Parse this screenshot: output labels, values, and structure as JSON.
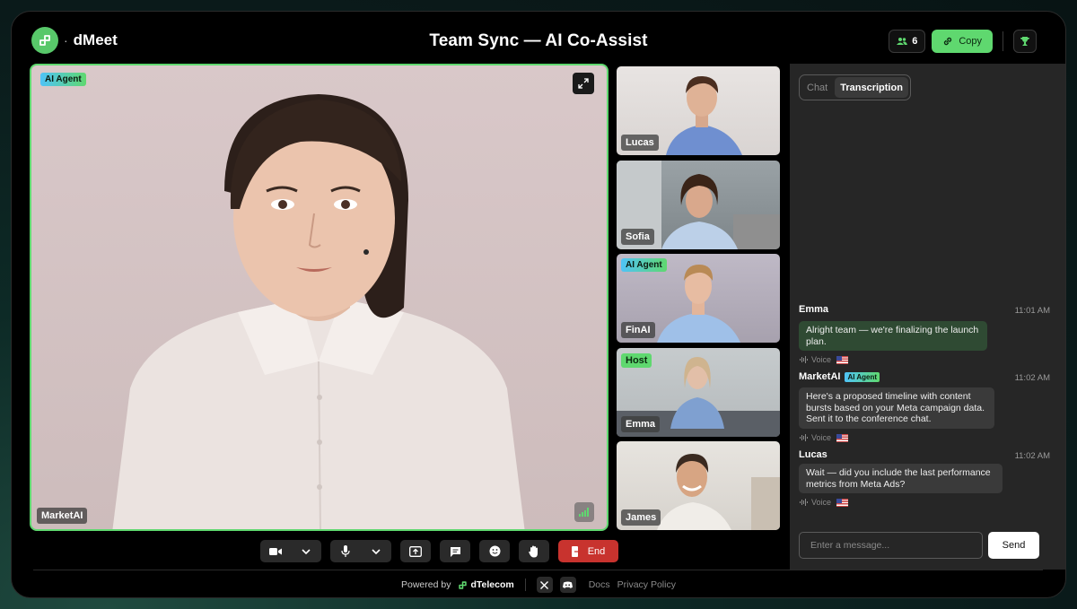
{
  "header": {
    "brand": "dMeet",
    "title": "Team Sync — AI Co-Assist",
    "participant_count": "6",
    "copy_label": "Copy"
  },
  "main_video": {
    "tag": "AI Agent",
    "name": "MarketAI"
  },
  "tiles": [
    {
      "name": "Lucas",
      "tag": ""
    },
    {
      "name": "Sofia",
      "tag": ""
    },
    {
      "name": "FinAI",
      "tag": "AI Agent"
    },
    {
      "name": "Emma",
      "tag": "Host"
    },
    {
      "name": "James",
      "tag": ""
    }
  ],
  "panel": {
    "tabs": [
      "Chat",
      "Transcription"
    ],
    "active_tab": "Transcription",
    "messages": [
      {
        "author": "Emma",
        "time": "11:01 AM",
        "text1": "Alright team — we're finalizing the launch",
        "text2": "plan.",
        "text3": "",
        "source": "Voice"
      },
      {
        "author": "MarketAI",
        "badge": "AI Agent",
        "time": "11:02 AM",
        "text1": "Here's a proposed timeline with content",
        "text2": "bursts based on your Meta campaign data.",
        "text3": "Sent it to the conference chat.",
        "source": "Voice"
      },
      {
        "author": "Lucas",
        "time": "11:02 AM",
        "text1": "Wait — did you include the last performance",
        "text2": "metrics from Meta Ads?",
        "text3": "",
        "source": "Voice"
      }
    ],
    "input_placeholder": "Enter a message...",
    "send_label": "Send"
  },
  "controls": {
    "end_label": "End"
  },
  "footer": {
    "powered_by": "Powered by",
    "company": "dTelecom",
    "docs": "Docs",
    "privacy": "Privacy Policy"
  },
  "colors": {
    "accent": "#5fd86f",
    "end": "#c8332e",
    "panel": "#262626"
  }
}
